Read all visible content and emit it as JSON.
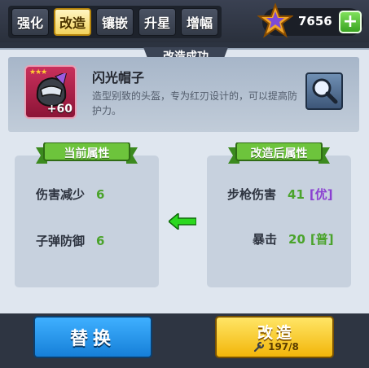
{
  "tabs": [
    {
      "label": "强化"
    },
    {
      "label": "改造"
    },
    {
      "label": "镶嵌"
    },
    {
      "label": "升星"
    },
    {
      "label": "增幅"
    }
  ],
  "active_tab": "改造",
  "currency": {
    "amount": "7656",
    "icon": "star-badge-icon"
  },
  "panel": {
    "title": "改造成功"
  },
  "item": {
    "name": "闪光帽子",
    "level": "+60",
    "stars": "★★★",
    "description": "造型别致的头盔，专为红刃设计的，可以提高防护力。",
    "icon": "helmet-icon"
  },
  "current_stats": {
    "title": "当前属性",
    "rows": [
      {
        "name": "伤害减少",
        "value": "6"
      },
      {
        "name": "子弹防御",
        "value": "6"
      }
    ]
  },
  "new_stats": {
    "title": "改造后属性",
    "rows": [
      {
        "name": "步枪伤害",
        "value": "41",
        "grade": "[优]"
      },
      {
        "name": "暴击",
        "value": "20",
        "grade": "[普]"
      }
    ]
  },
  "buttons": {
    "replace": "替换",
    "reform": "改造",
    "reform_cost": "197/8"
  },
  "colors": {
    "accent_green": "#4aa32b",
    "grade_excellent": "#8a3fd1",
    "replace_blue": "#1f8fe8",
    "reform_yellow": "#f6c21a"
  }
}
